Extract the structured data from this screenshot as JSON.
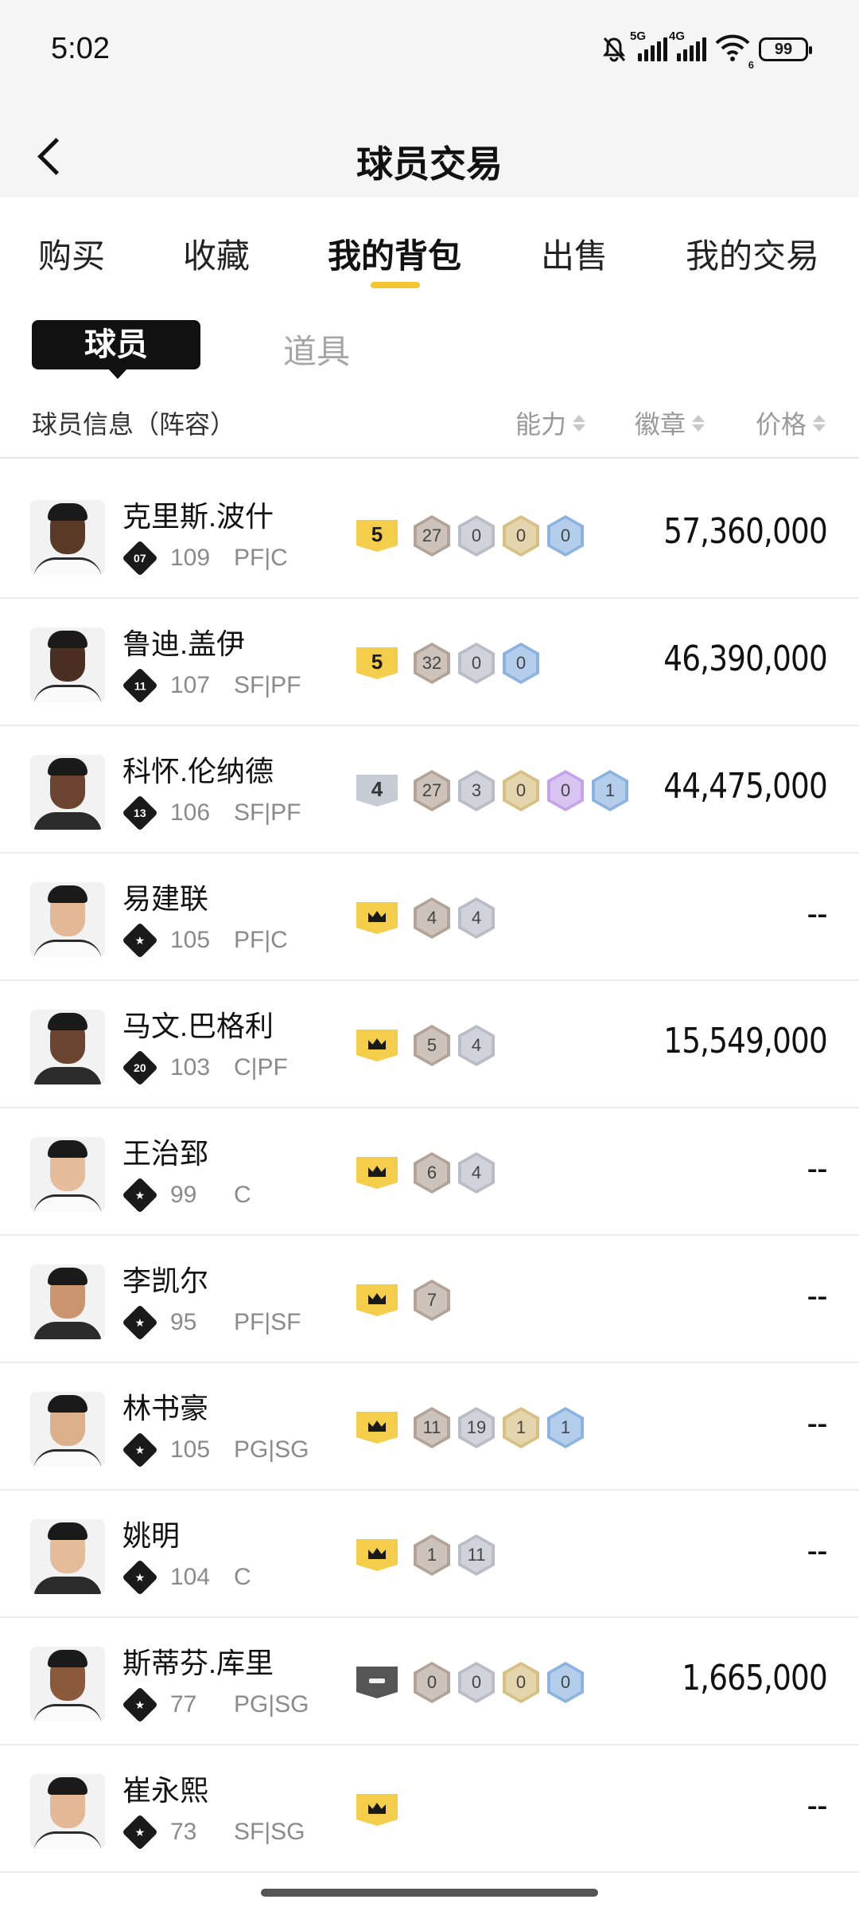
{
  "status_bar": {
    "time": "5:02",
    "net1": "5G",
    "net2": "4G",
    "wifi_sub": "6",
    "battery": "99"
  },
  "header": {
    "title": "球员交易"
  },
  "tabs": [
    "购买",
    "收藏",
    "我的背包",
    "出售",
    "我的交易"
  ],
  "active_tab_index": 2,
  "segments": {
    "players": "球员",
    "items": "道具"
  },
  "columns": {
    "info": "球员信息（阵容）",
    "ability": "能力",
    "badges": "徽章",
    "price": "价格"
  },
  "colors": {
    "accent": "#f5c431",
    "gold_tier": "#f5cd4d",
    "text": "#111111",
    "muted": "#8a8a8a"
  },
  "players": [
    {
      "name": "克里斯.波什",
      "lineup": "07",
      "ovr": "109",
      "pos": "PF|C",
      "tier": "5",
      "tier_style": "gold",
      "badges": [
        {
          "v": "27",
          "c": "bronze"
        },
        {
          "v": "0",
          "c": "silver"
        },
        {
          "v": "0",
          "c": "gold"
        },
        {
          "v": "0",
          "c": "blue"
        }
      ],
      "price": "57,360,000",
      "skin": "#5a3a26",
      "shirt": "light"
    },
    {
      "name": "鲁迪.盖伊",
      "lineup": "11",
      "ovr": "107",
      "pos": "SF|PF",
      "tier": "5",
      "tier_style": "gold",
      "badges": [
        {
          "v": "32",
          "c": "bronze"
        },
        {
          "v": "0",
          "c": "silver"
        },
        {
          "v": "0",
          "c": "blue"
        }
      ],
      "price": "46,390,000",
      "skin": "#4a2f22",
      "shirt": "light"
    },
    {
      "name": "科怀.伦纳德",
      "lineup": "13",
      "ovr": "106",
      "pos": "SF|PF",
      "tier": "4",
      "tier_style": "silver",
      "badges": [
        {
          "v": "27",
          "c": "bronze"
        },
        {
          "v": "3",
          "c": "silver"
        },
        {
          "v": "0",
          "c": "gold"
        },
        {
          "v": "0",
          "c": "purple"
        },
        {
          "v": "1",
          "c": "blue"
        }
      ],
      "price": "44,475,000",
      "skin": "#6b4330",
      "shirt": "dark"
    },
    {
      "name": "易建联",
      "lineup": "",
      "ovr": "105",
      "pos": "PF|C",
      "tier": "",
      "tier_style": "crown",
      "badges": [
        {
          "v": "4",
          "c": "bronze"
        },
        {
          "v": "4",
          "c": "silver"
        }
      ],
      "price": "--",
      "skin": "#e2b896",
      "shirt": "light"
    },
    {
      "name": "马文.巴格利",
      "lineup": "20",
      "ovr": "103",
      "pos": "C|PF",
      "tier": "",
      "tier_style": "crown",
      "badges": [
        {
          "v": "5",
          "c": "bronze"
        },
        {
          "v": "4",
          "c": "silver"
        }
      ],
      "price": "15,549,000",
      "skin": "#6a4430",
      "shirt": "dark"
    },
    {
      "name": "王治郅",
      "lineup": "",
      "ovr": "99",
      "pos": "C",
      "tier": "",
      "tier_style": "crown",
      "badges": [
        {
          "v": "6",
          "c": "bronze"
        },
        {
          "v": "4",
          "c": "silver"
        }
      ],
      "price": "--",
      "skin": "#e6bd9c",
      "shirt": "light"
    },
    {
      "name": "李凯尔",
      "lineup": "",
      "ovr": "95",
      "pos": "PF|SF",
      "tier": "",
      "tier_style": "crown",
      "badges": [
        {
          "v": "7",
          "c": "bronze"
        }
      ],
      "price": "--",
      "skin": "#c9946e",
      "shirt": "dark"
    },
    {
      "name": "林书豪",
      "lineup": "",
      "ovr": "105",
      "pos": "PG|SG",
      "tier": "",
      "tier_style": "crown",
      "badges": [
        {
          "v": "11",
          "c": "bronze"
        },
        {
          "v": "19",
          "c": "silver"
        },
        {
          "v": "1",
          "c": "gold"
        },
        {
          "v": "1",
          "c": "blue"
        }
      ],
      "price": "--",
      "skin": "#dcb08a",
      "shirt": "light"
    },
    {
      "name": "姚明",
      "lineup": "",
      "ovr": "104",
      "pos": "C",
      "tier": "",
      "tier_style": "crown",
      "badges": [
        {
          "v": "1",
          "c": "bronze"
        },
        {
          "v": "11",
          "c": "silver"
        }
      ],
      "price": "--",
      "skin": "#e4bc9a",
      "shirt": "dark"
    },
    {
      "name": "斯蒂芬.库里",
      "lineup": "",
      "ovr": "77",
      "pos": "PG|SG",
      "tier": "",
      "tier_style": "dark",
      "badges": [
        {
          "v": "0",
          "c": "bronze"
        },
        {
          "v": "0",
          "c": "silver"
        },
        {
          "v": "0",
          "c": "gold"
        },
        {
          "v": "0",
          "c": "blue"
        }
      ],
      "price": "1,665,000",
      "skin": "#8b5a3c",
      "shirt": "light"
    },
    {
      "name": "崔永熙",
      "lineup": "",
      "ovr": "73",
      "pos": "SF|SG",
      "tier": "",
      "tier_style": "crown",
      "badges": [],
      "price": "--",
      "skin": "#e2b896",
      "shirt": "light"
    }
  ]
}
